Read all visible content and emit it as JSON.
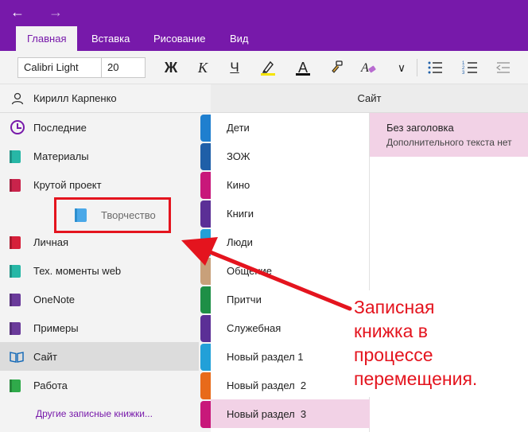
{
  "nav": {
    "back": "←",
    "forward": "→"
  },
  "tabs": [
    {
      "label": "Главная"
    },
    {
      "label": "Вставка"
    },
    {
      "label": "Рисование"
    },
    {
      "label": "Вид"
    }
  ],
  "toolbar": {
    "font_name": "Calibri Light",
    "font_size": "20",
    "bold": "Ж",
    "italic": "К",
    "underline": "Ч",
    "font_color": "A",
    "more": "∨"
  },
  "user": {
    "name": "Кирилл Карпенко"
  },
  "notebooks": [
    {
      "label": "Последние",
      "icon": "clock-icon"
    },
    {
      "label": "Материалы",
      "color": "#27b7a6"
    },
    {
      "label": "Крутой проект",
      "color": "#c9234b"
    },
    {
      "label": "Личная",
      "color": "#d6203a"
    },
    {
      "label": "Тех. моменты web",
      "color": "#27b7a6"
    },
    {
      "label": "OneNote",
      "color": "#6a3a9a"
    },
    {
      "label": "Примеры",
      "color": "#6a3a9a"
    },
    {
      "label": "Сайт",
      "icon": "book-open-icon"
    },
    {
      "label": "Работа",
      "color": "#2faa4a"
    }
  ],
  "more_notebooks": "Другие записные книжки...",
  "dragging": {
    "label": "Творчество",
    "color": "#4aa8e8"
  },
  "header": {
    "title": "Сайт"
  },
  "sections": [
    {
      "label": "Дети",
      "color": "#1f7fcf"
    },
    {
      "label": "ЗОЖ",
      "color": "#1f5fa8"
    },
    {
      "label": "Кино",
      "color": "#c8187a"
    },
    {
      "label": "Книги",
      "color": "#5b2f96"
    },
    {
      "label": "Люди",
      "color": "#22a0d8"
    },
    {
      "label": "Общение",
      "color": "#c8a07a"
    },
    {
      "label": "Притчи",
      "color": "#1e8f46"
    },
    {
      "label": "Служебная",
      "color": "#5b2f96"
    },
    {
      "label": "Новый раздел 1",
      "color": "#22a0d8"
    },
    {
      "label": "Новый раздел  2",
      "color": "#e86a1a"
    },
    {
      "label": "Новый раздел  3",
      "color": "#c8187a"
    }
  ],
  "page": {
    "title": "Без заголовка",
    "subtitle": "Дополнительного текста нет"
  },
  "annotation": {
    "lines": [
      "Записная",
      "книжка в",
      "процессе",
      "перемещения."
    ]
  }
}
